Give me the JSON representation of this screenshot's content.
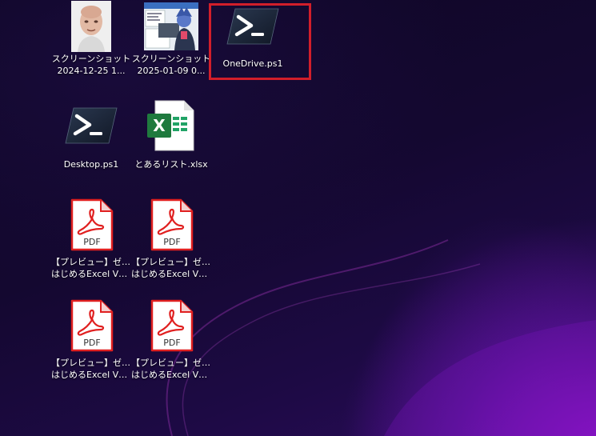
{
  "desktop": {
    "icons": [
      {
        "label": "スクリーンショット",
        "label2": "2024-12-25 1...",
        "icon": "photo-thumbnail-icon"
      },
      {
        "label": "スクリーンショット",
        "label2": "2025-01-09 0...",
        "icon": "screenshot-thumbnail-icon"
      },
      {
        "label": "OneDrive.ps1",
        "icon": "powershell-icon",
        "selected": true
      },
      {
        "label": "Desktop.ps1",
        "icon": "powershell-icon"
      },
      {
        "label": "とあるリスト.xlsx",
        "icon": "excel-icon"
      },
      {
        "label": "【プレビュー】ゼロから",
        "label2": "はじめるExcel VB...",
        "icon": "pdf-icon"
      },
      {
        "label": "【プレビュー】ゼロから",
        "label2": "はじめるExcel VB...",
        "icon": "pdf-icon"
      },
      {
        "label": "【プレビュー】ゼロから",
        "label2": "はじめるExcel VB...",
        "icon": "pdf-icon"
      },
      {
        "label": "【プレビュー】ゼロから",
        "label2": "はじめるExcel VB...",
        "icon": "pdf-icon"
      }
    ],
    "pdf_badge": "PDF",
    "excel_letter": "X"
  },
  "colors": {
    "selection_border": "#d21e2a",
    "pdf_red": "#e02020",
    "excel_green": "#1f7a3e",
    "powershell_bg": "#1b2535"
  }
}
